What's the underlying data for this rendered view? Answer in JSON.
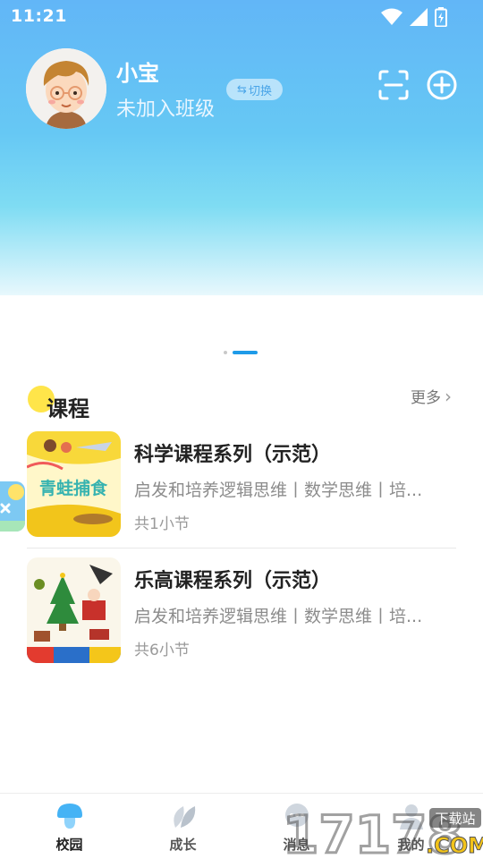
{
  "status": {
    "time": "11:21"
  },
  "user": {
    "name": "小宝",
    "class_status": "未加入班级",
    "switch_label": "切换",
    "switch_glyph": "⇆"
  },
  "carousel": {
    "pages": 2,
    "active": 2
  },
  "section": {
    "title": "课程",
    "more": "更多",
    "more_glyph": "›"
  },
  "courses": [
    {
      "title": "科学课程系列（示范）",
      "desc": "启发和培养逻辑思维丨数学思维丨培...",
      "count": "共1小节",
      "thumb_text": "青蛙捕食"
    },
    {
      "title": "乐高课程系列（示范）",
      "desc": "启发和培养逻辑思维丨数学思维丨培...",
      "count": "共6小节"
    }
  ],
  "tabs": [
    {
      "label": "校园",
      "icon": "mushroom-icon",
      "active": true
    },
    {
      "label": "成长",
      "icon": "leaf-icon",
      "active": false
    },
    {
      "label": "消息",
      "icon": "message-icon",
      "active": false
    },
    {
      "label": "我的",
      "icon": "profile-icon",
      "active": false
    }
  ],
  "watermark": {
    "number": "17178",
    "suffix": ".COM",
    "tag": "下载站"
  },
  "colors": {
    "accent": "#1e9be8",
    "hero_top": "#62b6f7",
    "section_dot": "#ffe54a"
  }
}
